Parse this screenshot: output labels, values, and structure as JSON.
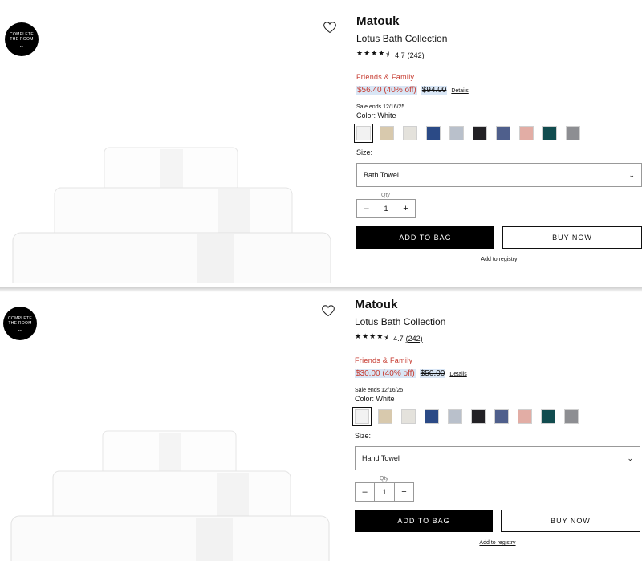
{
  "views": [
    {
      "badge": {
        "line1": "COMPLETE",
        "line2": "THE ROOM"
      },
      "brand": "Matouk",
      "product": "Lotus Bath Collection",
      "rating": {
        "value": "4.7",
        "count": "(242)",
        "stars": 4.5
      },
      "promo": "Friends & Family",
      "price": {
        "sale": "$56.40 (40% off)",
        "original": "$94.00",
        "details": "Details"
      },
      "sale_ends": "Sale ends 12/16/25",
      "color_label": "Color: White",
      "swatches": [
        "#f2f2f2",
        "#d8c9ad",
        "#e4e2dc",
        "#2b4a86",
        "#b9c0cb",
        "#222125",
        "#4f5f8c",
        "#e2ada5",
        "#114c4f",
        "#8d8e92"
      ],
      "size_label": "Size:",
      "size_value": "Bath Towel",
      "qty_label": "Qty",
      "qty_value": "1",
      "add_to_bag": "ADD TO BAG",
      "buy_now": "BUY NOW",
      "registry": "Add to registry"
    },
    {
      "badge": {
        "line1": "COMPLETE",
        "line2": "THE ROOM"
      },
      "brand": "Matouk",
      "product": "Lotus Bath Collection",
      "rating": {
        "value": "4.7",
        "count": "(242)",
        "stars": 4.5
      },
      "promo": "Friends & Family",
      "price": {
        "sale": "$30.00 (40% off)",
        "original": "$50.00",
        "details": "Details"
      },
      "sale_ends": "Sale ends 12/16/25",
      "color_label": "Color: White",
      "swatches": [
        "#f2f2f2",
        "#d8c9ad",
        "#e4e2dc",
        "#2b4a86",
        "#b9c0cb",
        "#222125",
        "#4f5f8c",
        "#e2ada5",
        "#114c4f",
        "#8d8e92"
      ],
      "size_label": "Size:",
      "size_value": "Hand Towel",
      "qty_label": "Qty",
      "qty_value": "1",
      "add_to_bag": "ADD TO BAG",
      "buy_now": "BUY NOW",
      "registry": "Add to registry"
    }
  ],
  "icons": {
    "heart": "heart-icon",
    "chevron": "chevron-down-icon",
    "minus": "minus-icon",
    "plus": "plus-icon",
    "star": "star-icon"
  }
}
